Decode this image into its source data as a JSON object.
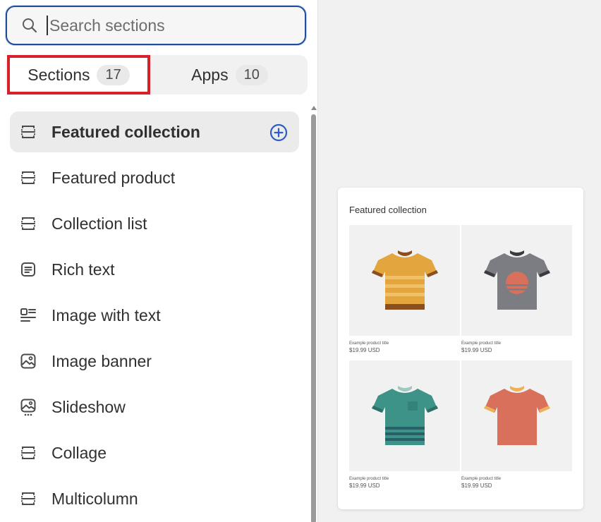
{
  "search": {
    "placeholder": "Search sections",
    "icon": "search-icon"
  },
  "tabs": [
    {
      "label": "Sections",
      "count": "17",
      "selected": true
    },
    {
      "label": "Apps",
      "count": "10",
      "selected": false
    }
  ],
  "sections": [
    {
      "label": "Featured collection",
      "icon": "section-icon",
      "active": true
    },
    {
      "label": "Featured product",
      "icon": "section-icon"
    },
    {
      "label": "Collection list",
      "icon": "section-icon"
    },
    {
      "label": "Rich text",
      "icon": "text-block-icon"
    },
    {
      "label": "Image with text",
      "icon": "image-with-text-icon"
    },
    {
      "label": "Image banner",
      "icon": "image-icon"
    },
    {
      "label": "Slideshow",
      "icon": "slideshow-icon"
    },
    {
      "label": "Collage",
      "icon": "section-icon"
    },
    {
      "label": "Multicolumn",
      "icon": "section-icon"
    }
  ],
  "preview": {
    "title": "Featured collection",
    "products": [
      {
        "title": "Example product title",
        "price": "$19.99 USD",
        "shirt_color": "#e3a53d"
      },
      {
        "title": "Example product title",
        "price": "$19.99 USD",
        "shirt_color": "#7b7d82"
      },
      {
        "title": "Example product title",
        "price": "$19.99 USD",
        "shirt_color": "#3d9387"
      },
      {
        "title": "Example product title",
        "price": "$19.99 USD",
        "shirt_color": "#d9705c"
      }
    ]
  },
  "colors": {
    "focus_ring": "#1f4e9a",
    "highlight_box": "#d6202a",
    "add_icon": "#2c5cc5"
  }
}
